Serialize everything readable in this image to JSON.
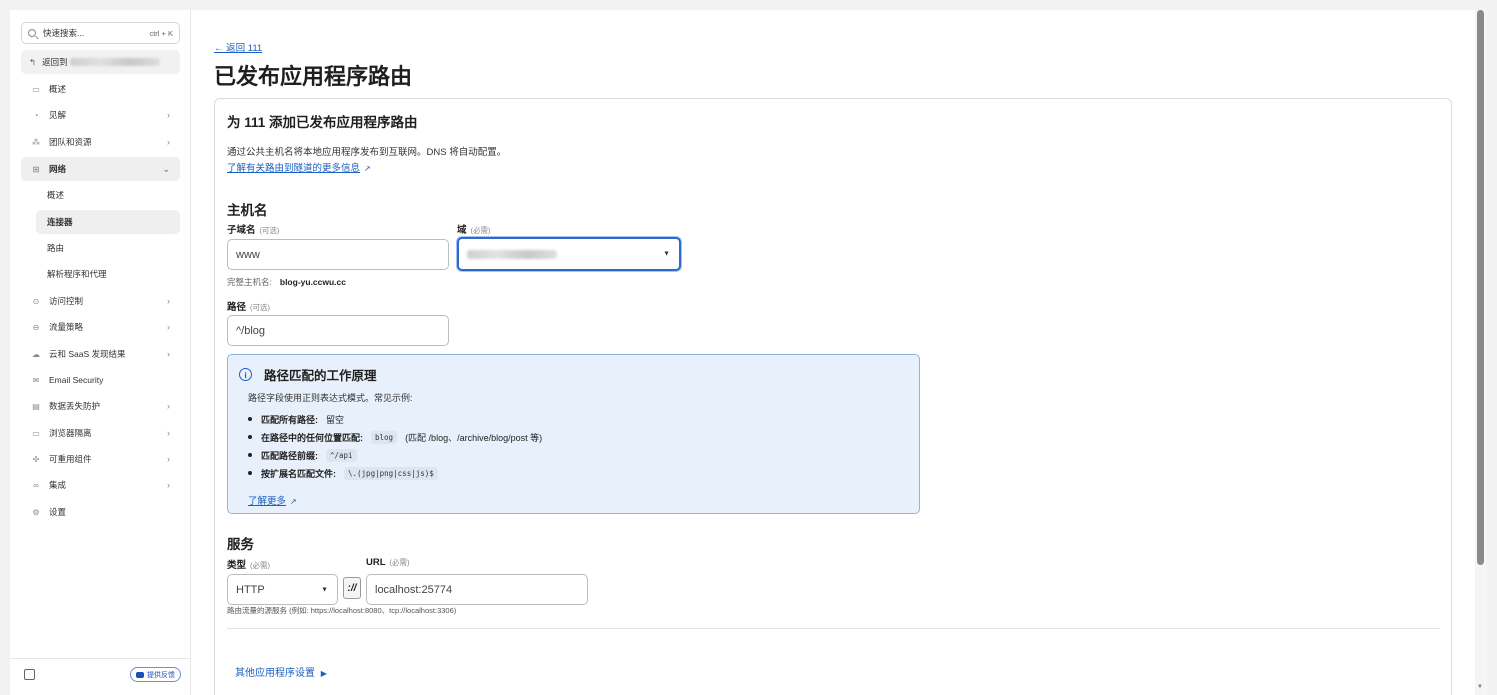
{
  "sidebar": {
    "search_placeholder": "快速搜索...",
    "search_shortcut": "ctrl + K",
    "back_account_label": "返回到",
    "items": [
      {
        "label": "概述",
        "icon": "calendar-icon",
        "chevron": ""
      },
      {
        "label": "见解",
        "icon": "insights-icon",
        "chevron": ">"
      },
      {
        "label": "团队和资源",
        "icon": "team-icon",
        "chevron": ">"
      },
      {
        "label": "网络",
        "icon": "network-icon",
        "chevron": "⌄"
      }
    ],
    "network_sub": [
      {
        "label": "概述"
      },
      {
        "label": "连接器"
      },
      {
        "label": "路由"
      },
      {
        "label": "解析程序和代理"
      }
    ],
    "items_after": [
      {
        "label": "访问控制",
        "icon": "access-icon",
        "chevron": ">"
      },
      {
        "label": "流量策略",
        "icon": "traffic-icon",
        "chevron": ">"
      },
      {
        "label": "云和 SaaS 发现结果",
        "icon": "cloud-icon",
        "chevron": ">"
      },
      {
        "label": "Email Security",
        "icon": "email-icon",
        "chevron": ""
      },
      {
        "label": "数据丢失防护",
        "icon": "dlp-icon",
        "chevron": ">"
      },
      {
        "label": "浏览器隔离",
        "icon": "browser-icon",
        "chevron": ">"
      },
      {
        "label": "可重用组件",
        "icon": "components-icon",
        "chevron": ">"
      },
      {
        "label": "集成",
        "icon": "integrations-icon",
        "chevron": ">"
      },
      {
        "label": "设置",
        "icon": "gear-icon",
        "chevron": ""
      }
    ],
    "feedback_label": "提供反馈"
  },
  "main": {
    "back_link": "← 返回 111",
    "page_title": "已发布应用程序路由",
    "card": {
      "title": "为 111 添加已发布应用程序路由",
      "intro": "通过公共主机名将本地应用程序发布到互联网。DNS 将自动配置。",
      "learn_link": "了解有关路由到隧道的更多信息",
      "hostname_heading": "主机名",
      "subdomain_label": "子域名",
      "subdomain_optional": "(可选)",
      "subdomain_value": "www",
      "domain_label": "域",
      "domain_required": "(必需)",
      "full_hostname_label": "完整主机名:",
      "full_hostname_value": "blog-yu.ccwu.cc",
      "path_label": "路径",
      "path_optional": "(可选)",
      "path_value": "^/blog",
      "info": {
        "title": "路径匹配的工作原理",
        "desc": "路径字段使用正则表达式模式。常见示例:",
        "items": [
          {
            "label": "匹配所有路径:",
            "code": "",
            "text": "留空"
          },
          {
            "label": "在路径中的任何位置匹配:",
            "code": "blog",
            "text": "(匹配 /blog、/archive/blog/post 等)"
          },
          {
            "label": "匹配路径前缀:",
            "code": "^/api",
            "text": ""
          },
          {
            "label": "按扩展名匹配文件:",
            "code": "\\.(jpg|png|css|js)$",
            "text": ""
          }
        ],
        "learn_more": "了解更多"
      },
      "service_heading": "服务",
      "type_label": "类型",
      "type_required": "(必需)",
      "type_value": "HTTP",
      "separator": "://",
      "url_label": "URL",
      "url_required": "(必需)",
      "url_value": "localhost:25774",
      "service_hint": "路由流量的源服务 (例如: https://localhost:8080、tcp://localhost:3306)",
      "more_settings": "其他应用程序设置"
    }
  },
  "colors": {
    "accent": "#2a6bd1",
    "link": "#1a5fc0",
    "info_bg": "#e8f1fb"
  }
}
